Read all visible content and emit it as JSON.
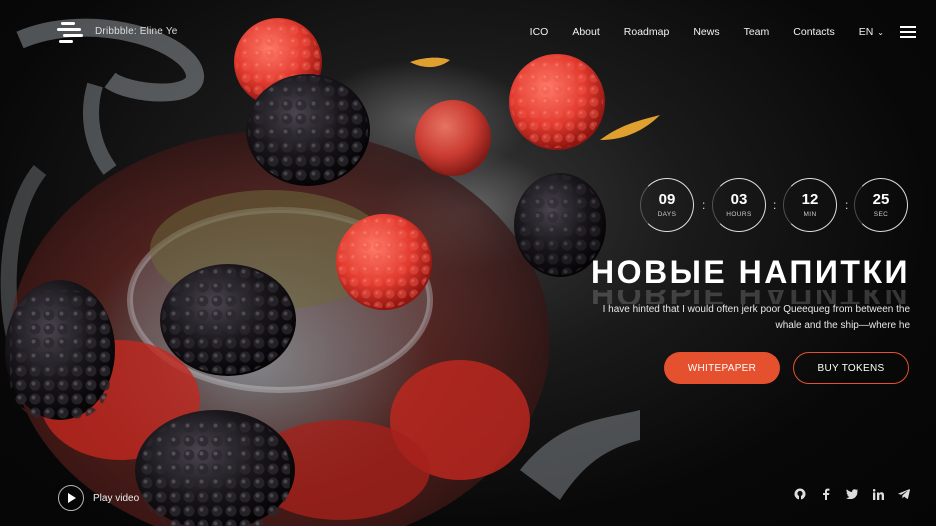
{
  "header": {
    "brand": "Dribbble: Eline Ye",
    "nav": [
      "ICO",
      "About",
      "Roadmap",
      "News",
      "Team",
      "Contacts"
    ],
    "lang": "EN"
  },
  "countdown": [
    {
      "value": "09",
      "label": "DAYS"
    },
    {
      "value": "03",
      "label": "HOURS"
    },
    {
      "value": "12",
      "label": "MIN"
    },
    {
      "value": "25",
      "label": "SEC"
    }
  ],
  "hero": {
    "title": "НОВЫЕ НАПИТКИ",
    "subtitle_line1": "I have hinted that I would often jerk poor Queequeg from between the",
    "subtitle_line2": "whale and the ship—where he"
  },
  "buttons": {
    "primary": "WHITEPAPER",
    "secondary": "BUY TOKENS"
  },
  "play": {
    "label": "Play video"
  },
  "colors": {
    "accent": "#e5502e",
    "background": "#0a0a0a"
  },
  "icons": [
    "github-icon",
    "facebook-icon",
    "twitter-icon",
    "linkedin-icon",
    "telegram-icon"
  ]
}
